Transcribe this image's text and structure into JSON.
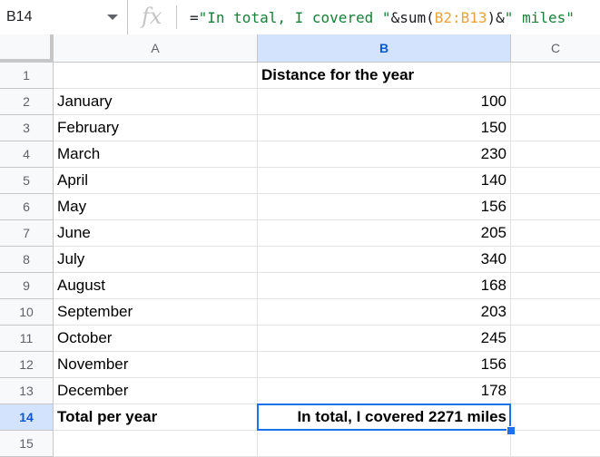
{
  "name_box": "B14",
  "formula": {
    "eq": "=",
    "str1": "\"In total, I covered \"",
    "op1": "&sum(",
    "ref": "B2:B13",
    "op2": ")&",
    "str2": "\" miles\""
  },
  "columns": [
    "A",
    "B",
    "C"
  ],
  "rows": [
    {
      "num": "1",
      "a": "",
      "b": "Distance for the year"
    },
    {
      "num": "2",
      "a": "January",
      "b": "100"
    },
    {
      "num": "3",
      "a": "February",
      "b": "150"
    },
    {
      "num": "4",
      "a": "March",
      "b": "230"
    },
    {
      "num": "5",
      "a": "April",
      "b": "140"
    },
    {
      "num": "6",
      "a": "May",
      "b": "156"
    },
    {
      "num": "7",
      "a": "June",
      "b": "205"
    },
    {
      "num": "8",
      "a": "July",
      "b": "340"
    },
    {
      "num": "9",
      "a": "August",
      "b": "168"
    },
    {
      "num": "10",
      "a": "September",
      "b": "203"
    },
    {
      "num": "11",
      "a": "October",
      "b": "245"
    },
    {
      "num": "12",
      "a": "November",
      "b": "156"
    },
    {
      "num": "13",
      "a": "December",
      "b": "178"
    },
    {
      "num": "14",
      "a": "Total per year",
      "b": "In total, I covered 2271 miles"
    },
    {
      "num": "15",
      "a": "",
      "b": ""
    }
  ],
  "icons": {
    "name_box_dropdown": "chevron-down-icon",
    "function": "fx-icon"
  },
  "colors": {
    "selection": "#1a73e8",
    "header_bg": "#f8f9fa",
    "header_selected_bg": "#d3e3fd"
  }
}
